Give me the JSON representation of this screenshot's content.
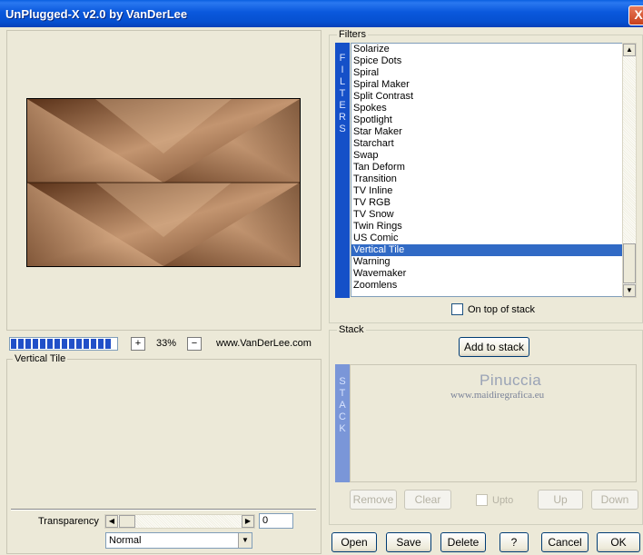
{
  "window": {
    "title": "UnPlugged-X v2.0 by VanDerLee",
    "close_label": "X"
  },
  "preview": {
    "zoom_plus": "+",
    "zoom_value": "33%",
    "zoom_minus": "−",
    "url": "www.VanDerLee.com",
    "progress_segments": 12
  },
  "params": {
    "legend": "Vertical Tile",
    "transparency_label": "Transparency",
    "transparency_value": "0",
    "blend_mode": "Normal"
  },
  "filters": {
    "legend": "Filters",
    "side_tag": [
      "F",
      "I",
      "L",
      "T",
      "E",
      "R",
      "S"
    ],
    "items": [
      "Solarize",
      "Spice Dots",
      "Spiral",
      "Spiral Maker",
      "Split Contrast",
      "Spokes",
      "Spotlight",
      "Star Maker",
      "Starchart",
      "Swap",
      "Tan Deform",
      "Transition",
      "TV Inline",
      "TV RGB",
      "TV Snow",
      "Twin Rings",
      "US Comic",
      "Vertical Tile",
      "Warning",
      "Wavemaker",
      "Zoomlens"
    ],
    "selected": "Vertical Tile",
    "on_top_label": "On top of stack"
  },
  "stack": {
    "legend": "Stack",
    "add_label": "Add to stack",
    "side_tag": [
      "S",
      "T",
      "A",
      "C",
      "K"
    ],
    "watermark_title": "Pinuccia",
    "watermark_url": "www.maidiregrafica.eu",
    "remove_label": "Remove",
    "clear_label": "Clear",
    "upto_label": "Upto",
    "up_label": "Up",
    "down_label": "Down"
  },
  "footer": {
    "open": "Open",
    "save": "Save",
    "delete": "Delete",
    "help": "?",
    "cancel": "Cancel",
    "ok": "OK"
  },
  "colors": {
    "title_bar": "#0a58dc",
    "selection": "#316ac5",
    "filter_tag": "#1550c8",
    "stack_tag": "#7a96d8"
  }
}
